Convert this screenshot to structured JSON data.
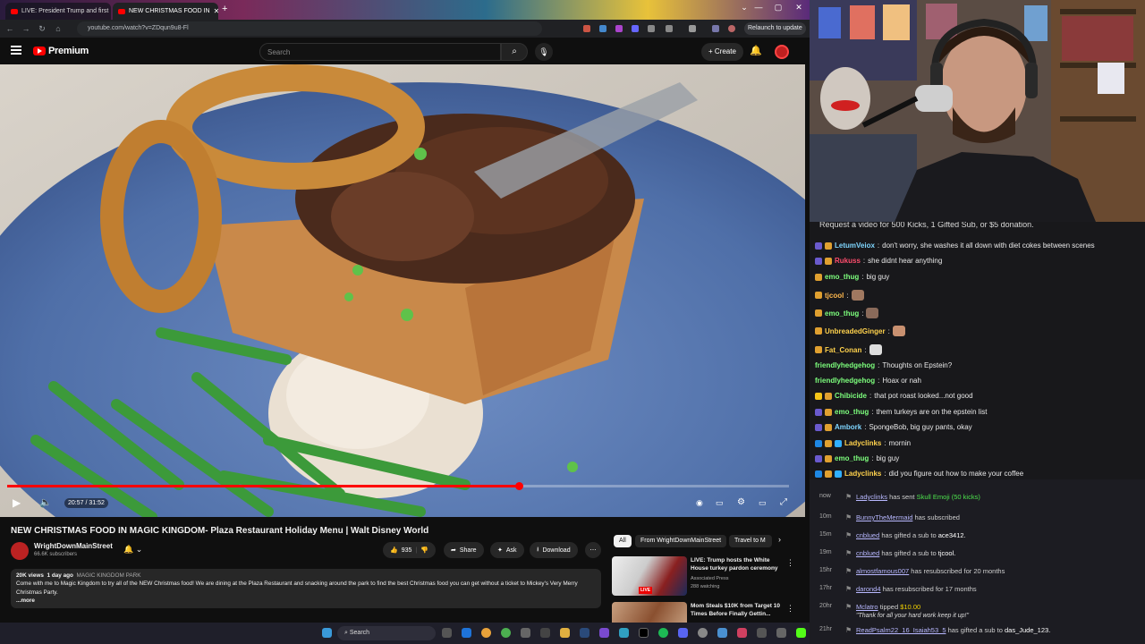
{
  "browser": {
    "tabs": [
      {
        "title": "LIVE: President Trump and first"
      },
      {
        "title": "NEW CHRISTMAS FOOD IN"
      }
    ],
    "new_tab": "+",
    "url": "youtube.com/watch?v=ZDqun9u8-Fl",
    "relaunch_label": "Relaunch to update",
    "win_controls": [
      "⌄",
      "—",
      "▢",
      "✕"
    ]
  },
  "youtube": {
    "logo_text": "Premium",
    "search_placeholder": "Search",
    "create_label": "Create",
    "player": {
      "time": "20:57 / 31:52",
      "progress": 0.655
    },
    "video_title": "NEW CHRISTMAS FOOD IN MAGIC KINGDOM- Plaza Restaurant Holiday Menu | Walt Disney World",
    "channel": {
      "name": "WrightDownMainStreet",
      "subscribers": "66.6K subscribers"
    },
    "actions": {
      "likes": "935",
      "share": "Share",
      "ask": "Ask",
      "download": "Download"
    },
    "description": {
      "views": "20K views",
      "age": "1 day ago",
      "tag": "MAGIC KINGDOM PARK",
      "text": "Come with me to Magic Kingdom to try all of the NEW Christmas food! We are dining at the Plaza Restaurant and snacking around the park to find the best Christmas food you can get without a ticket to Mickey's Very Merry Christmas Party.",
      "more": "...more"
    },
    "chips": [
      "All",
      "From WrightDownMainStreet",
      "Travel to M"
    ],
    "recommendations": [
      {
        "title": "LIVE: Trump hosts the White House turkey pardon ceremony",
        "channel": "Associated Press",
        "meta": "288 watching",
        "badge": "LIVE"
      },
      {
        "title": "Mom Steals $10K from Target 10 Times Before Finally Gettin...",
        "channel": "",
        "meta": "",
        "badge": ""
      }
    ]
  },
  "chat": {
    "banner": "Request a video for 500 Kicks, 1 Gifted Sub, or $5 donation.",
    "messages": [
      {
        "user": "LetumVeiox",
        "color": "#7fd6ff",
        "text": "don't worry, she washes it all down with diet cokes between scenes"
      },
      {
        "user": "Rukuss",
        "color": "#ff4d6d",
        "text": "she didnt hear anything"
      },
      {
        "user": "emo_thug",
        "color": "#7dff7d",
        "text": "big guy"
      },
      {
        "user": "tjcool",
        "color": "#ffb84d",
        "text": ""
      },
      {
        "user": "emo_thug",
        "color": "#7dff7d",
        "text": ""
      },
      {
        "user": "UnbreadedGinger",
        "color": "#ffd24d",
        "text": ""
      },
      {
        "user": "Fat_Conan",
        "color": "#ffd24d",
        "text": ""
      },
      {
        "user": "friendlyhedgehog",
        "color": "#7dff7d",
        "text": "Thoughts on Epstein?"
      },
      {
        "user": "friendlyhedgehog",
        "color": "#7dff7d",
        "text": "Hoax or nah"
      },
      {
        "user": "Chibicide",
        "color": "#7dff7d",
        "text": "that pot roast looked...not good"
      },
      {
        "user": "emo_thug",
        "color": "#7dff7d",
        "text": "them turkeys are on the epstein list"
      },
      {
        "user": "Ambork",
        "color": "#7fd6ff",
        "text": "SpongeBob, big guy pants, okay"
      },
      {
        "user": "Ladyclinks",
        "color": "#ffd24d",
        "text": "mornin"
      },
      {
        "user": "emo_thug",
        "color": "#7dff7d",
        "text": "big guy"
      },
      {
        "user": "Ladyclinks",
        "color": "#ffd24d",
        "text": "did you figure out how to make your coffee"
      }
    ]
  },
  "events": [
    {
      "time": "now",
      "user": "Ladyclinks",
      "text": "has sent",
      "extra": "Skull Emoji (50 kicks)"
    },
    {
      "time": "10m",
      "user": "BunnyTheMermaid",
      "text": "has subscribed",
      "extra": ""
    },
    {
      "time": "15m",
      "user": "cnblued",
      "text": "has gifted a sub to",
      "extra": "ace3412."
    },
    {
      "time": "19m",
      "user": "cnblued",
      "text": "has gifted a sub to",
      "extra": "tjcool."
    },
    {
      "time": "15hr",
      "user": "almostfamous007",
      "text": "has resubscribed for 20 months",
      "extra": ""
    },
    {
      "time": "17hr",
      "user": "darond4",
      "text": "has resubscribed for 17 months",
      "extra": ""
    },
    {
      "time": "20hr",
      "user": "Mclatro",
      "text": "tipped",
      "extra": "$10.00",
      "quote": "\"Thank for all your hard work keep it up!\""
    },
    {
      "time": "21hr",
      "user": "ReadPsalm22_16_Isaiah53_5",
      "text": "has gifted a sub to",
      "extra": "das_Jude_123."
    }
  ],
  "taskbar": {
    "search_label": "Search"
  }
}
